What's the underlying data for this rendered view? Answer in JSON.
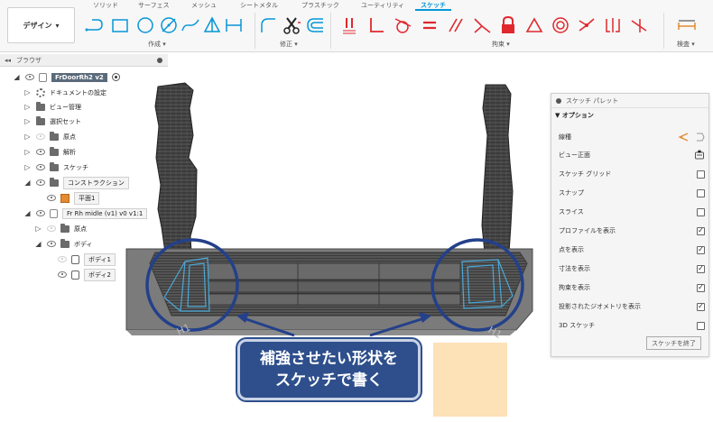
{
  "toolbar": {
    "design_button": "デザイン",
    "tabs": [
      "ソリッド",
      "サーフェス",
      "メッシュ",
      "シートメタル",
      "プラスチック",
      "ユーティリティ",
      "スケッチ"
    ],
    "active_tab": "スケッチ",
    "groups": {
      "create": "作成",
      "modify": "修正",
      "constraints": "拘束",
      "inspect": "検査"
    },
    "accent_color": "#0696d7",
    "constraint_color": "#e0282e"
  },
  "browser": {
    "title": "ブラウザ",
    "root": "FrDoorRh2 v2",
    "items": [
      {
        "label": "ドキュメントの設定",
        "icon": "gear-icon"
      },
      {
        "label": "ビュー管理",
        "icon": "folder-icon"
      },
      {
        "label": "選択セット",
        "icon": "folder-icon"
      },
      {
        "label": "原点",
        "icon": "folder-icon"
      },
      {
        "label": "解析",
        "icon": "folder-icon"
      },
      {
        "label": "スケッチ",
        "icon": "folder-icon"
      },
      {
        "label": "コンストラクション",
        "icon": "folder-icon"
      },
      {
        "label": "平面1",
        "icon": "plane-icon"
      },
      {
        "label": "Fr Rh midle (v1) v0 v1:1",
        "icon": "component-icon"
      },
      {
        "label": "原点",
        "icon": "folder-icon"
      },
      {
        "label": "ボディ",
        "icon": "folder-icon"
      },
      {
        "label": "ボディ1",
        "icon": "body-icon"
      },
      {
        "label": "ボディ2",
        "icon": "body-icon"
      }
    ]
  },
  "palette": {
    "title": "スケッチ パレット",
    "section": "オプション",
    "rows": [
      {
        "label": "線種",
        "control": "linetype"
      },
      {
        "label": "ビュー正面",
        "control": "view"
      },
      {
        "label": "スケッチ グリッド",
        "checked": false
      },
      {
        "label": "スナップ",
        "checked": false
      },
      {
        "label": "スライス",
        "checked": false
      },
      {
        "label": "プロファイルを表示",
        "checked": true
      },
      {
        "label": "点を表示",
        "checked": true
      },
      {
        "label": "寸法を表示",
        "checked": true
      },
      {
        "label": "拘束を表示",
        "checked": true
      },
      {
        "label": "投影されたジオメトリを表示",
        "checked": true
      },
      {
        "label": "3D スケッチ",
        "checked": false
      }
    ],
    "finish_button": "スケッチを終了"
  },
  "callout": {
    "line1": "補強させたい形状を",
    "line2": "スケッチで書く",
    "color": "#2e4f8c"
  }
}
